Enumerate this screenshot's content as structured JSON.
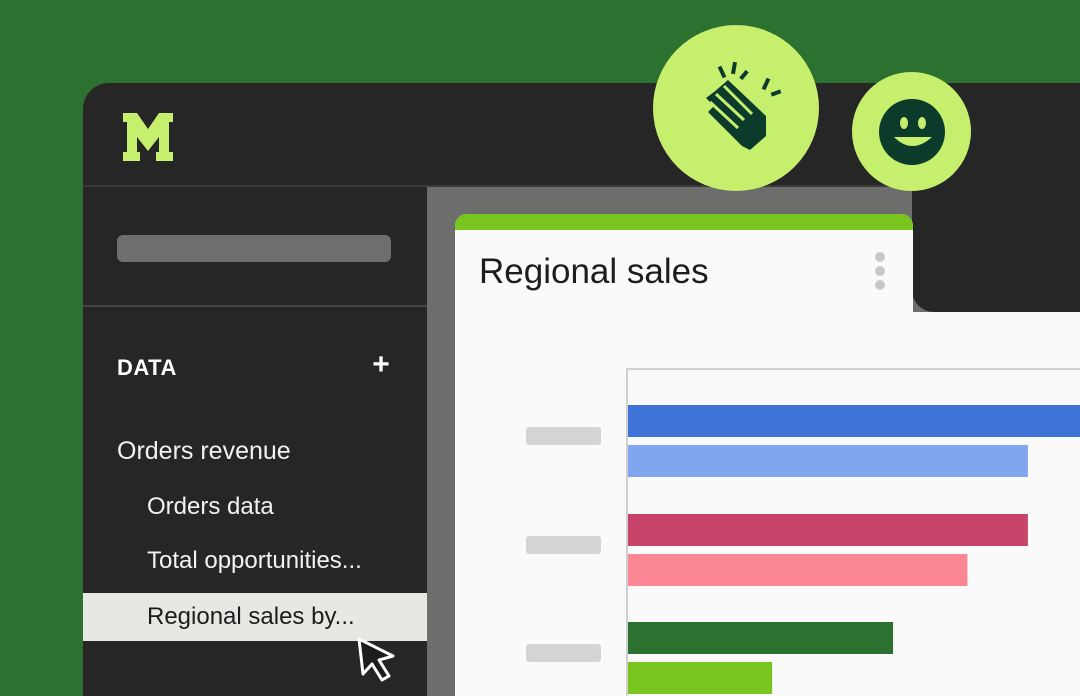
{
  "app": {
    "logo_letter": "M",
    "brand_color": "#c7ef6e"
  },
  "sidebar": {
    "section_title": "DATA",
    "add_label": "+",
    "items": [
      {
        "label": "Orders revenue",
        "level": 1
      },
      {
        "label": "Orders data",
        "level": 2
      },
      {
        "label": "Total opportunities...",
        "level": 2
      },
      {
        "label": "Regional sales by...",
        "level": 2,
        "active": true
      }
    ]
  },
  "card": {
    "title": "Regional sales",
    "accent_color": "#78c51f",
    "menu_icon": "kebab-vertical-icon"
  },
  "reactions": [
    {
      "icon": "clapping-hands-icon"
    },
    {
      "icon": "smiley-face-icon"
    }
  ],
  "chart_data": {
    "type": "bar",
    "orientation": "horizontal",
    "categories": [
      "",
      "",
      ""
    ],
    "series": [
      {
        "values": [
          100,
          86,
          57
        ],
        "colors": [
          "#3f73d8",
          "#c9446b",
          "#2c7130"
        ]
      },
      {
        "values": [
          86,
          73,
          31
        ],
        "colors": [
          "#80a6f0",
          "#fc8794",
          "#78c51f"
        ]
      }
    ],
    "grid": false,
    "legend": "none",
    "title": "",
    "xlabel": "",
    "ylabel": ""
  }
}
